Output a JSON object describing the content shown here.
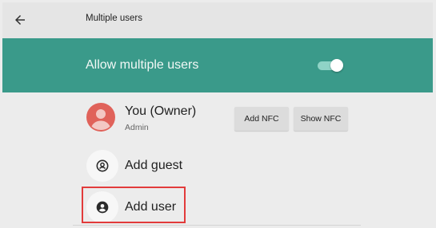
{
  "header": {
    "back_icon": "arrow-left-icon",
    "title": "Multiple users"
  },
  "toggle": {
    "label": "Allow multiple users",
    "enabled": true,
    "colors": {
      "row_background": "#3a9a8a",
      "track": "#8fd3c6",
      "thumb": "#ffffff"
    }
  },
  "owner": {
    "name": "You (Owner)",
    "role": "Admin",
    "avatar_icon": "user-avatar-icon",
    "avatar_color": "#e0625a",
    "buttons": {
      "add_nfc": "Add NFC",
      "show_nfc": "Show NFC"
    }
  },
  "items": [
    {
      "label": "Add guest",
      "icon": "guest-icon"
    },
    {
      "label": "Add user",
      "icon": "add-user-icon"
    }
  ],
  "highlight_color": "#e23b3b"
}
